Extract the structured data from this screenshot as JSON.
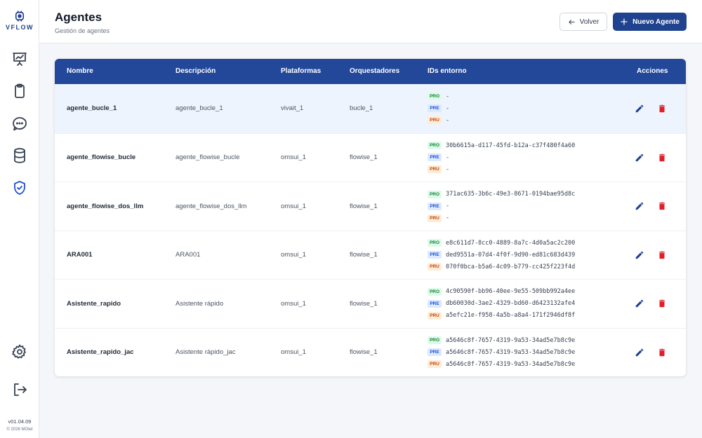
{
  "app": {
    "logo_text": "VFLOW",
    "version": "v01.04.09",
    "copyright": "© 2026 MOtel"
  },
  "sidebar": {
    "items": [
      {
        "name": "dashboard",
        "icon": "chart-icon"
      },
      {
        "name": "clipboard",
        "icon": "clipboard-icon"
      },
      {
        "name": "chat",
        "icon": "chat-icon"
      },
      {
        "name": "database",
        "icon": "database-icon"
      },
      {
        "name": "agents",
        "icon": "shield-check-icon",
        "active": true
      }
    ],
    "bottom": [
      {
        "name": "settings",
        "icon": "gear-icon"
      },
      {
        "name": "logout",
        "icon": "logout-icon"
      }
    ]
  },
  "header": {
    "title": "Agentes",
    "subtitle": "Gestión de agentes",
    "back_label": "Volver",
    "new_label": "Nuevo Agente"
  },
  "table": {
    "columns": [
      "Nombre",
      "Descripción",
      "Plataformas",
      "Orquestadores",
      "IDs entorno",
      "Acciones"
    ],
    "env_labels": [
      "PRO",
      "PRE",
      "PRU"
    ],
    "rows": [
      {
        "name": "agente_bucle_1",
        "description": "agente_bucle_1",
        "platform": "vivait_1",
        "orchestrator": "bucle_1",
        "ids": [
          "-",
          "-",
          "-"
        ]
      },
      {
        "name": "agente_flowise_bucle",
        "description": "agente_flowise_bucle",
        "platform": "omsui_1",
        "orchestrator": "flowise_1",
        "ids": [
          "30b6615a-d117-45fd-b12a-c37f480f4a60",
          "-",
          "-"
        ]
      },
      {
        "name": "agente_flowise_dos_llm",
        "description": "agente_flowise_dos_llm",
        "platform": "omsui_1",
        "orchestrator": "flowise_1",
        "ids": [
          "371ac635-3b6c-49e3-8671-0194bae95d8c",
          "-",
          "-"
        ]
      },
      {
        "name": "ARA001",
        "description": "ARA001",
        "platform": "omsui_1",
        "orchestrator": "flowise_1",
        "ids": [
          "e8c611d7-8cc0-4889-8a7c-4d0a5ac2c200",
          "ded9551a-07d4-4f0f-9d90-ed81c683d439",
          "070f0bca-b5a6-4c09-b779-cc425f223f4d"
        ]
      },
      {
        "name": "Asistente_rapido",
        "description": "Asistente rápido",
        "platform": "omsui_1",
        "orchestrator": "flowise_1",
        "ids": [
          "4c90590f-bb96-40ee-9e55-509bb992a4ee",
          "db60030d-3ae2-4329-bd60-d6423132afe4",
          "a5efc21e-f958-4a5b-a8a4-171f2946df8f"
        ]
      },
      {
        "name": "Asistente_rapido_jac",
        "description": "Asistente rápido_jac",
        "platform": "omsui_1",
        "orchestrator": "flowise_1",
        "ids": [
          "a5646c8f-7657-4319-9a53-34ad5e7b8c9e",
          "a5646c8f-7657-4319-9a53-34ad5e7b8c9e",
          "a5646c8f-7657-4319-9a53-34ad5e7b8c9e"
        ]
      }
    ]
  },
  "colors": {
    "primary": "#1f438f",
    "header_row": "#23489a",
    "edit": "#1f3f8f",
    "delete": "#e11d2a",
    "active_nav": "#1d4ed8",
    "nav": "#374151"
  }
}
